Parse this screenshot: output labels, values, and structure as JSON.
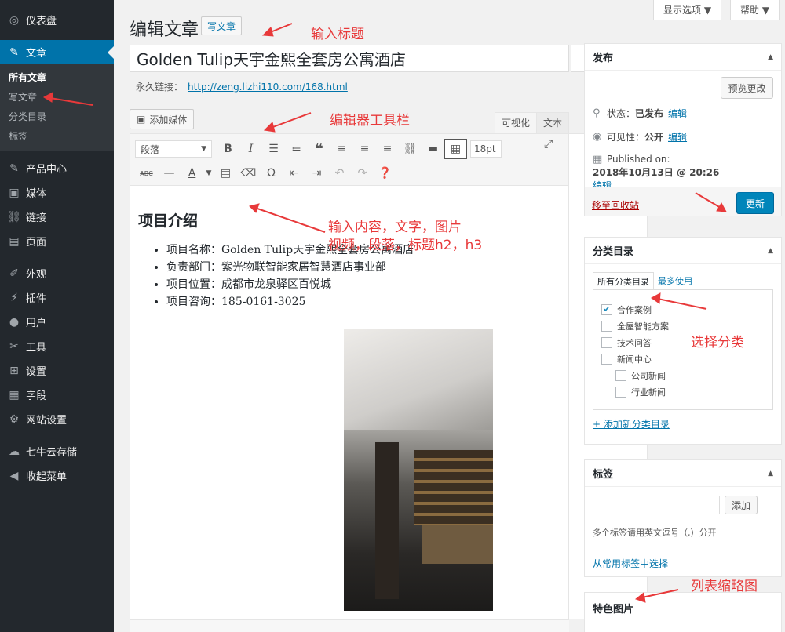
{
  "sidebar": {
    "items_top": [
      {
        "icon": "dashboard-icon",
        "glyph": "◎",
        "label": "仪表盘"
      }
    ],
    "posts": {
      "icon": "pin-icon",
      "glyph": "✎",
      "label": "文章"
    },
    "submenu": [
      "所有文章",
      "写文章",
      "分类目录",
      "标签"
    ],
    "items": [
      {
        "icon": "pin-icon",
        "glyph": "✎",
        "label": "产品中心"
      },
      {
        "icon": "media-icon",
        "glyph": "▣",
        "label": "媒体"
      },
      {
        "icon": "link-icon",
        "glyph": "⛓",
        "label": "链接"
      },
      {
        "icon": "page-icon",
        "glyph": "▤",
        "label": "页面"
      },
      {
        "icon": "appearance-icon",
        "glyph": "✐",
        "label": "外观"
      },
      {
        "icon": "plugin-icon",
        "glyph": "⚡",
        "label": "插件"
      },
      {
        "icon": "user-icon",
        "glyph": "●",
        "label": "用户"
      },
      {
        "icon": "tools-icon",
        "glyph": "✂",
        "label": "工具"
      },
      {
        "icon": "settings-icon",
        "glyph": "⊞",
        "label": "设置"
      },
      {
        "icon": "fields-icon",
        "glyph": "▦",
        "label": "字段"
      },
      {
        "icon": "gear-icon",
        "glyph": "⚙",
        "label": "网站设置"
      }
    ],
    "items_bottom": [
      {
        "icon": "cloud-icon",
        "glyph": "☁",
        "label": "七牛云存储"
      },
      {
        "icon": "collapse-icon",
        "glyph": "◀",
        "label": "收起菜单"
      }
    ]
  },
  "header": {
    "screen_options": "显示选项 ▼",
    "help": "帮助 ▼",
    "page_title": "编辑文章",
    "write_button": "写文章"
  },
  "post": {
    "title": "Golden Tulip天宇金熙全套房公寓酒店",
    "permalink_label": "永久链接：",
    "permalink_url": "http://zeng.lizhi110.com/168.html"
  },
  "editor": {
    "add_media": "添加媒体",
    "tab_visual": "可视化",
    "tab_text": "文本",
    "format_select": "段落",
    "font_size": "18pt",
    "content_heading": "项目介绍",
    "content_list": [
      "项目名称：Golden Tulip天宇金熙全套房公寓酒店",
      "负责部门：紫光物联智能家居智慧酒店事业部",
      "项目位置：成都市龙泉驿区百悦城",
      "项目咨询：185-0161-3025"
    ]
  },
  "publish": {
    "title": "发布",
    "preview": "预览更改",
    "status_label": "状态：",
    "status_value": "已发布",
    "visibility_label": "可见性：",
    "visibility_value": "公开",
    "published_label": "Published on:",
    "published_value": "2018年10月13日 @ 20:26",
    "edit": "编辑",
    "trash": "移至回收站",
    "update": "更新"
  },
  "categories": {
    "title": "分类目录",
    "tab_all": "所有分类目录",
    "tab_popular": "最多使用",
    "items": [
      {
        "label": "合作案例",
        "checked": true,
        "child": false
      },
      {
        "label": "全屋智能方案",
        "checked": false,
        "child": false
      },
      {
        "label": "技术问答",
        "checked": false,
        "child": false
      },
      {
        "label": "新闻中心",
        "checked": false,
        "child": false
      },
      {
        "label": "公司新闻",
        "checked": false,
        "child": true
      },
      {
        "label": "行业新闻",
        "checked": false,
        "child": true
      }
    ],
    "add_new": "+ 添加新分类目录"
  },
  "tags": {
    "title": "标签",
    "add": "添加",
    "hint": "多个标签请用英文逗号（,）分开",
    "choose": "从常用标签中选择"
  },
  "featured": {
    "title": "特色图片"
  },
  "annotations": {
    "title": "输入标题",
    "toolbar": "编辑器工具栏",
    "content_line1": "输入内容，文字，图片",
    "content_line2": "视频，段落，标题h2，h3",
    "category": "选择分类",
    "thumbnail": "列表缩略图"
  },
  "colors": {
    "accent": "#0073aa",
    "sidebar": "#23282d",
    "annotation": "#e8393a"
  }
}
